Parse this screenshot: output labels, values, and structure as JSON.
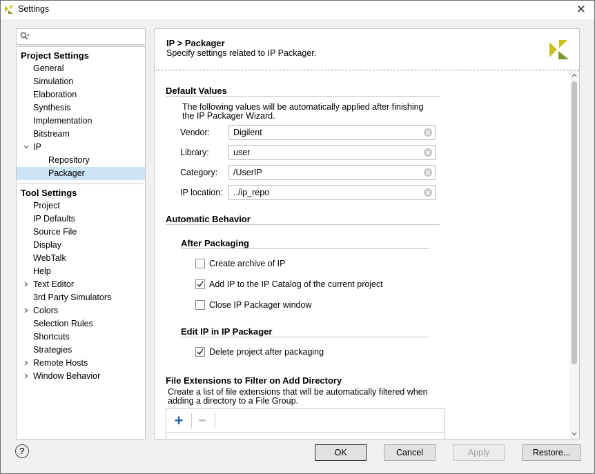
{
  "window": {
    "title": "Settings"
  },
  "search": {
    "placeholder": ""
  },
  "tree": {
    "project_header": "Project Settings",
    "project_items": [
      "General",
      "Simulation",
      "Elaboration",
      "Synthesis",
      "Implementation",
      "Bitstream"
    ],
    "ip": "IP",
    "ip_children": [
      "Repository",
      "Packager"
    ],
    "selected": "Packager",
    "tool_header": "Tool Settings",
    "tool_items": [
      "Project",
      "IP Defaults",
      "Source File",
      "Display",
      "WebTalk",
      "Help",
      "Text Editor",
      "3rd Party Simulators",
      "Colors",
      "Selection Rules",
      "Shortcuts",
      "Strategies",
      "Remote Hosts",
      "Window Behavior"
    ],
    "expandable_tool_items": [
      "Text Editor",
      "Colors",
      "Remote Hosts",
      "Window Behavior"
    ]
  },
  "page": {
    "title": "IP > Packager",
    "subtitle": "Specify settings related to IP Packager."
  },
  "defaults": {
    "heading": "Default Values",
    "description": "The following values will be automatically applied after finishing the IP Packager Wizard.",
    "vendor_label": "Vendor:",
    "vendor_value": "Digilent",
    "library_label": "Library:",
    "library_value": "user",
    "category_label": "Category:",
    "category_value": "/UserIP",
    "location_label": "IP location:",
    "location_value": "../ip_repo"
  },
  "automatic": {
    "heading": "Automatic Behavior",
    "after_heading": "After Packaging",
    "create_archive": {
      "label": "Create archive of IP",
      "checked": false
    },
    "add_to_catalog": {
      "label": "Add IP to the IP Catalog of the current project",
      "checked": true
    },
    "close_window": {
      "label": "Close IP Packager window",
      "checked": false
    },
    "edit_heading": "Edit IP in IP Packager",
    "delete_project": {
      "label": "Delete project after packaging",
      "checked": true
    }
  },
  "extensions": {
    "heading": "File Extensions to Filter on Add Directory",
    "description": "Create a list of file extensions that will be automatically filtered when adding a directory to a File Group.",
    "add_glyph": "+",
    "remove_glyph": "−"
  },
  "buttons": {
    "ok": "OK",
    "cancel": "Cancel",
    "apply": "Apply",
    "restore": "Restore..."
  },
  "icons": {
    "help": "?",
    "close": "✕"
  },
  "colors": {
    "selection": "#cce4f7",
    "logo_yellow": "#d2c81c",
    "logo_green": "#7a9a2e",
    "add_blue": "#1f5fa8"
  }
}
